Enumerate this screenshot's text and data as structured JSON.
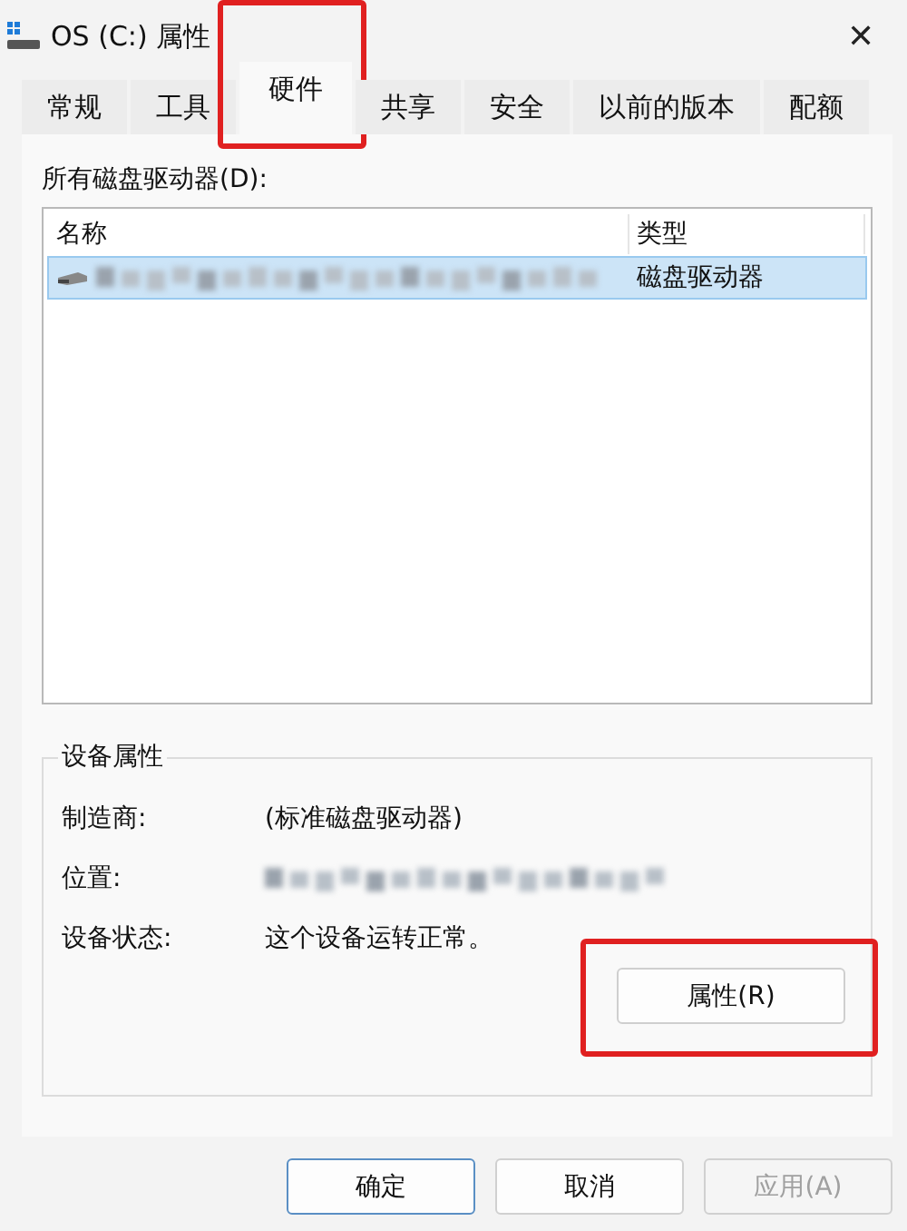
{
  "window": {
    "title": "OS (C:) 属性",
    "close": "✕"
  },
  "tabs": [
    {
      "label": "常规",
      "selected": false,
      "highlighted": false
    },
    {
      "label": "工具",
      "selected": false,
      "highlighted": false
    },
    {
      "label": "硬件",
      "selected": true,
      "highlighted": true
    },
    {
      "label": "共享",
      "selected": false,
      "highlighted": false
    },
    {
      "label": "安全",
      "selected": false,
      "highlighted": false
    },
    {
      "label": "以前的版本",
      "selected": false,
      "highlighted": false
    },
    {
      "label": "配额",
      "selected": false,
      "highlighted": false
    }
  ],
  "drives": {
    "label": "所有磁盘驱动器(D):",
    "columns": [
      "名称",
      "类型"
    ],
    "rows": [
      {
        "name_redacted": true,
        "type": "磁盘驱动器",
        "selected": true
      }
    ]
  },
  "device_properties": {
    "title": "设备属性",
    "fields": [
      {
        "kind": "text",
        "label": "制造商:",
        "value": "(标准磁盘驱动器)"
      },
      {
        "kind": "redacted",
        "label": "位置:"
      },
      {
        "kind": "text",
        "label": "设备状态:",
        "value": "这个设备运转正常。"
      }
    ],
    "button": {
      "label": "属性(R)",
      "highlighted": true
    }
  },
  "buttons": [
    {
      "label": "确定",
      "default": true,
      "disabled": false
    },
    {
      "label": "取消",
      "default": false,
      "disabled": false
    },
    {
      "label": "应用(A)",
      "default": false,
      "disabled": true
    }
  ]
}
